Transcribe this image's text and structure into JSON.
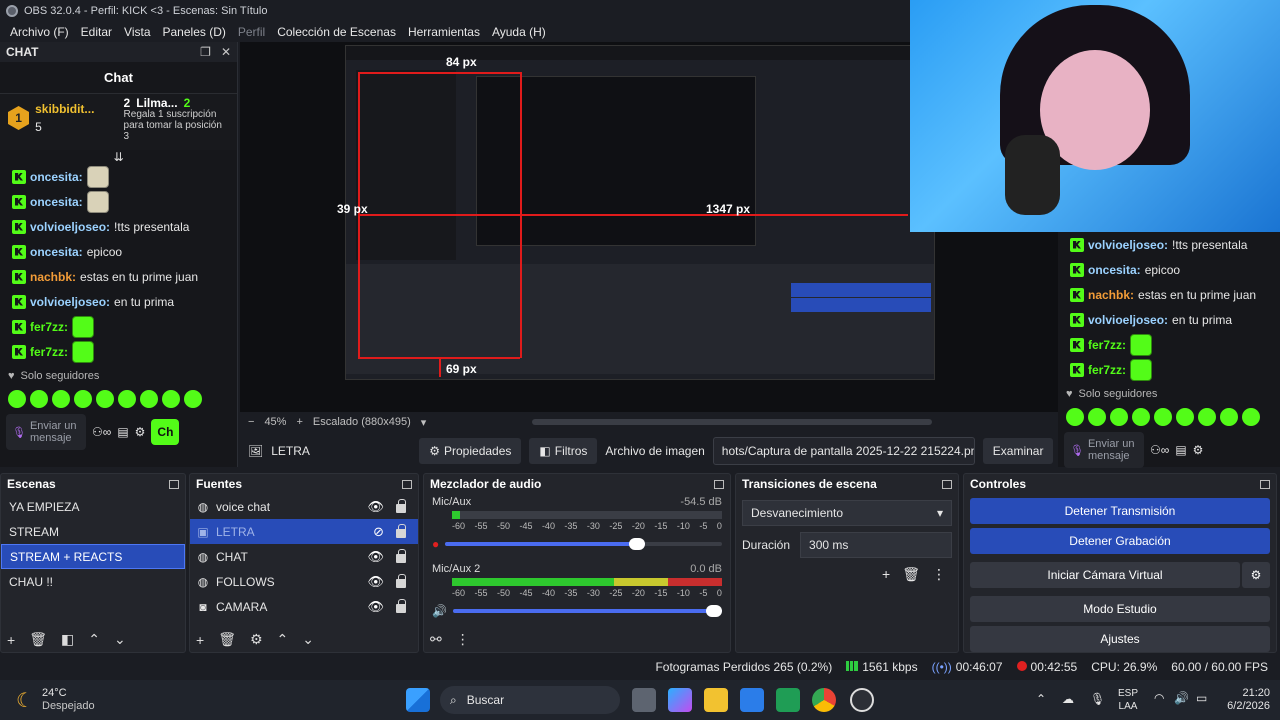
{
  "title_bar": {
    "title": "OBS 32.0.4 - Perfil: KICK <3 - Escenas: Sin Título"
  },
  "menu": [
    "Archivo (F)",
    "Editar",
    "Vista",
    "Paneles (D)",
    "Perfil",
    "Colección de Escenas",
    "Herramientas",
    "Ayuda (H)"
  ],
  "chat_dock": {
    "dock_title": "CHAT",
    "title": "Chat",
    "top_user": "skibbidit...",
    "top_count": "5",
    "gift_user": "Lilma...",
    "gift_rank": "2",
    "gift_count": "2",
    "gift_text": "Regala 1 suscripción para tomar la posición 3",
    "gold_rank": "1",
    "messages": [
      {
        "user": "oncesita:",
        "text": "",
        "color": "#9bd2ff"
      },
      {
        "user": "oncesita:",
        "text": "",
        "color": "#9bd2ff"
      },
      {
        "user": "volvioeljoseo:",
        "text": " !tts presentala",
        "color": "#9bd2ff"
      },
      {
        "user": "oncesita:",
        "text": " epicoo",
        "color": "#9bd2ff"
      },
      {
        "user": "nachbk:",
        "text": " estas en tu prime juan",
        "color": "#f29c38"
      },
      {
        "user": "volvioeljoseo:",
        "text": " en tu prima",
        "color": "#9bd2ff"
      },
      {
        "user": "fer7zz:",
        "text": "",
        "color": "#53fc18"
      },
      {
        "user": "fer7zz:",
        "text": "",
        "color": "#53fc18"
      }
    ],
    "followers_only": "Solo seguidores",
    "send_placeholder": "Enviar un mensaje",
    "chat_button": "Ch"
  },
  "right_chat": {
    "messages": [
      {
        "user": "volvioeljoseo:",
        "text": " !tts presentala",
        "color": "#9bd2ff"
      },
      {
        "user": "oncesita:",
        "text": " epicoo",
        "color": "#9bd2ff"
      },
      {
        "user": "nachbk:",
        "text": " estas en tu prime juan",
        "color": "#f29c38"
      },
      {
        "user": "volvioeljoseo:",
        "text": " en tu prima",
        "color": "#9bd2ff"
      },
      {
        "user": "fer7zz:",
        "text": "",
        "color": "#53fc18"
      },
      {
        "user": "fer7zz:",
        "text": "",
        "color": "#53fc18"
      }
    ],
    "followers_only": "Solo seguidores",
    "send_placeholder": "Enviar un mensaje"
  },
  "preview": {
    "measure_top": "84 px",
    "measure_left": "39 px",
    "measure_right": "1347 px",
    "measure_bottom": "69 px"
  },
  "zoom_bar": {
    "zoom": "45%",
    "scaling": "Escalado (880x495)"
  },
  "source_toolbar": {
    "source_name": "LETRA",
    "properties": "Propiedades",
    "filters": "Filtros",
    "image_label": "Archivo de imagen",
    "path": "hots/Captura de pantalla 2025-12-22 215224.png",
    "browse": "Examinar"
  },
  "scenes": {
    "title": "Escenas",
    "items": [
      "YA EMPIEZA",
      "STREAM",
      "STREAM + REACTS",
      "CHAU !!"
    ],
    "selected_index": 2
  },
  "sources": {
    "title": "Fuentes",
    "items": [
      {
        "name": "voice chat",
        "icon": "globe-icon",
        "visible": true,
        "selected": false
      },
      {
        "name": "LETRA",
        "icon": "image-icon",
        "visible": false,
        "selected": true
      },
      {
        "name": "CHAT",
        "icon": "globe-icon",
        "visible": true,
        "selected": false
      },
      {
        "name": "FOLLOWS",
        "icon": "globe-icon",
        "visible": true,
        "selected": false
      },
      {
        "name": "CAMARA",
        "icon": "camera-icon",
        "visible": true,
        "selected": false
      }
    ]
  },
  "mixer": {
    "title": "Mezclador de audio",
    "channels": [
      {
        "name": "Mic/Aux",
        "db": "-54.5 dB",
        "level": 0.03,
        "volume": 0.72,
        "muted": true
      },
      {
        "name": "Mic/Aux 2",
        "db": "0.0 dB",
        "level": 1.0,
        "volume": 1.0,
        "muted": false
      }
    ],
    "ticks": [
      "-60",
      "-55",
      "-50",
      "-45",
      "-40",
      "-35",
      "-30",
      "-25",
      "-20",
      "-15",
      "-10",
      "-5",
      "0"
    ]
  },
  "transitions": {
    "title": "Transiciones de escena",
    "selected": "Desvanecimiento",
    "duration_label": "Duración",
    "duration": "300 ms"
  },
  "controls": {
    "title": "Controles",
    "stop_stream": "Detener Transmisión",
    "stop_record": "Detener Grabación",
    "virtual_cam": "Iniciar Cámara Virtual",
    "studio_mode": "Modo Estudio",
    "settings": "Ajustes"
  },
  "status_bar": {
    "dropped": "Fotogramas Perdidos 265 (0.2%)",
    "bitrate": "1561 kbps",
    "stream_time": "00:46:07",
    "record_time": "00:42:55",
    "cpu": "CPU: 26.9%",
    "fps": "60.00 / 60.00 FPS"
  },
  "taskbar": {
    "temp": "24°C",
    "weather": "Despejado",
    "search": "Buscar",
    "lang1": "ESP",
    "lang2": "LAA",
    "time": "21:20",
    "date": "6/2/2026"
  },
  "colors": {
    "accent": "#284cb8",
    "kick_green": "#53fc18",
    "record_red": "#e02020"
  }
}
